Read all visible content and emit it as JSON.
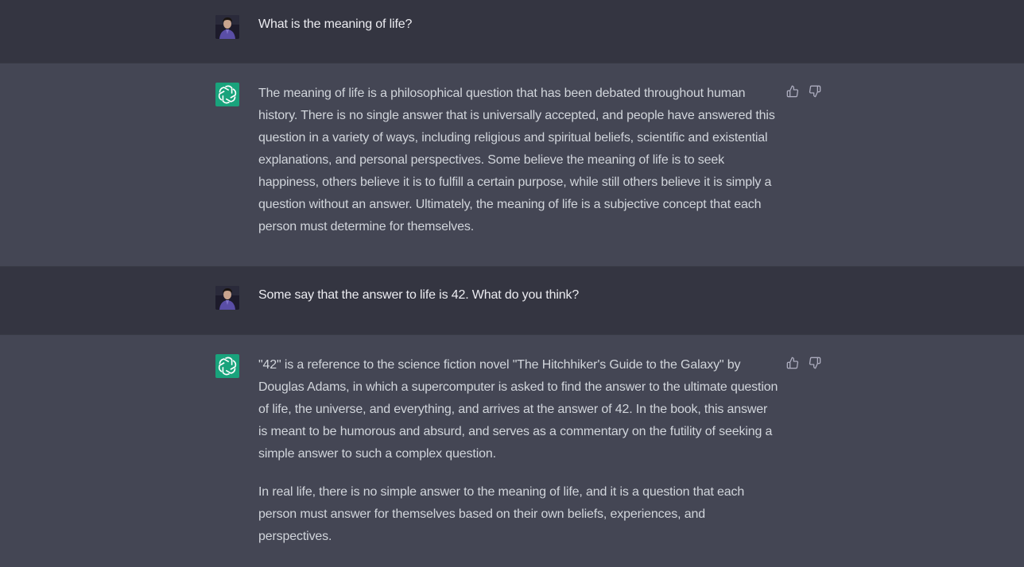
{
  "conversation": [
    {
      "role": "user",
      "avatar": "user-avatar",
      "paragraphs": [
        "What is the meaning of life?"
      ]
    },
    {
      "role": "assistant",
      "avatar": "openai-logo-icon",
      "paragraphs": [
        "The meaning of life is a philosophical question that has been debated throughout human history. There is no single answer that is universally accepted, and people have answered this question in a variety of ways, including religious and spiritual beliefs, scientific and existential explanations, and personal perspectives. Some believe the meaning of life is to seek happiness, others believe it is to fulfill a certain purpose, while still others believe it is simply a question without an answer. Ultimately, the meaning of life is a subjective concept that each person must determine for themselves."
      ],
      "feedback_icons": [
        "thumbs-up-icon",
        "thumbs-down-icon"
      ]
    },
    {
      "role": "user",
      "avatar": "user-avatar",
      "paragraphs": [
        "Some say that the answer to life is 42. What do you think?"
      ]
    },
    {
      "role": "assistant",
      "avatar": "openai-logo-icon",
      "paragraphs": [
        "\"42\" is a reference to the science fiction novel \"The Hitchhiker's Guide to the Galaxy\" by Douglas Adams, in which a supercomputer is asked to find the answer to the ultimate question of life, the universe, and everything, and arrives at the answer of 42. In the book, this answer is meant to be humorous and absurd, and serves as a commentary on the futility of seeking a simple answer to such a complex question.",
        "In real life, there is no simple answer to the meaning of life, and it is a question that each person must answer for themselves based on their own beliefs, experiences, and perspectives."
      ],
      "feedback_icons": [
        "thumbs-up-icon",
        "thumbs-down-icon"
      ]
    }
  ],
  "colors": {
    "user_bg": "#343541",
    "assistant_bg": "#444654",
    "user_text": "#ececf1",
    "assistant_text": "#d1d5db",
    "assistant_avatar_bg": "#19a37c",
    "icon_color": "#acacbe"
  }
}
